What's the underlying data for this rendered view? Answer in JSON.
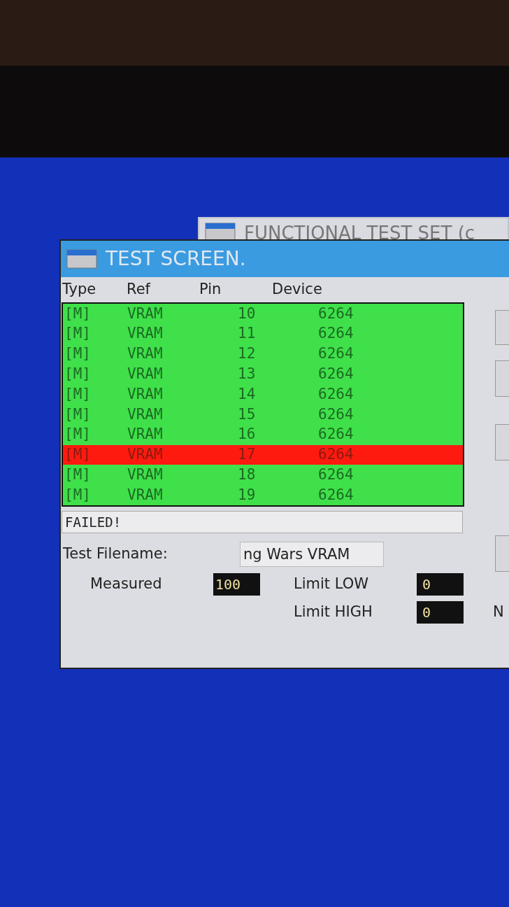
{
  "back_window": {
    "title": "FUNCTIONAL TEST SET (c"
  },
  "window": {
    "title": "TEST SCREEN."
  },
  "columns": [
    "Type",
    "Ref",
    "Pin",
    "Device"
  ],
  "rows": [
    {
      "type": "[M]",
      "ref": "VRAM",
      "pin": "10",
      "device": "6264",
      "failed": false
    },
    {
      "type": "[M]",
      "ref": "VRAM",
      "pin": "11",
      "device": "6264",
      "failed": false
    },
    {
      "type": "[M]",
      "ref": "VRAM",
      "pin": "12",
      "device": "6264",
      "failed": false
    },
    {
      "type": "[M]",
      "ref": "VRAM",
      "pin": "13",
      "device": "6264",
      "failed": false
    },
    {
      "type": "[M]",
      "ref": "VRAM",
      "pin": "14",
      "device": "6264",
      "failed": false
    },
    {
      "type": "[M]",
      "ref": "VRAM",
      "pin": "15",
      "device": "6264",
      "failed": false
    },
    {
      "type": "[M]",
      "ref": "VRAM",
      "pin": "16",
      "device": "6264",
      "failed": false
    },
    {
      "type": "[M]",
      "ref": "VRAM",
      "pin": "17",
      "device": "6264",
      "failed": true
    },
    {
      "type": "[M]",
      "ref": "VRAM",
      "pin": "18",
      "device": "6264",
      "failed": false
    },
    {
      "type": "[M]",
      "ref": "VRAM",
      "pin": "19",
      "device": "6264",
      "failed": false
    }
  ],
  "result": "FAILED!",
  "filename": {
    "label": "Test Filename:",
    "value": "ng Wars VRAM"
  },
  "measured": {
    "label": "Measured",
    "value": "100"
  },
  "limit_low": {
    "label": "Limit LOW",
    "value": "0"
  },
  "limit_high": {
    "label": "Limit HIGH",
    "value": "0"
  },
  "cut_label": "N"
}
